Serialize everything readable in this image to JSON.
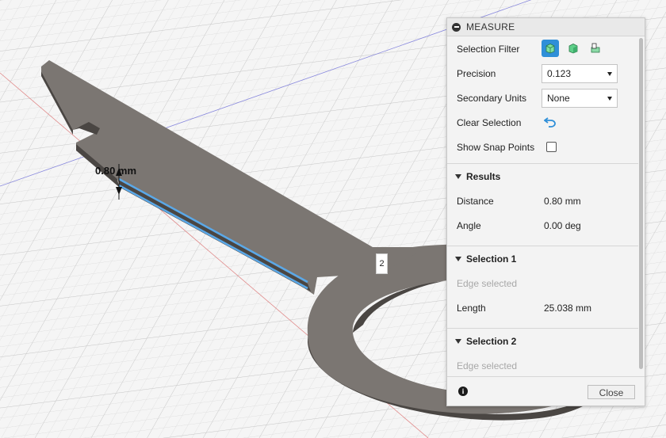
{
  "viewport": {
    "dimension_label": "0.80 mm",
    "vertex_label": "2"
  },
  "panel": {
    "title": "MEASURE",
    "selection_filter": {
      "label": "Selection Filter",
      "options": [
        "body-filter-icon",
        "face-filter-icon",
        "component-filter-icon"
      ],
      "active_index": 0
    },
    "precision": {
      "label": "Precision",
      "value": "0.123"
    },
    "secondary_units": {
      "label": "Secondary Units",
      "value": "None"
    },
    "clear_selection": {
      "label": "Clear Selection"
    },
    "show_snap_points": {
      "label": "Show Snap Points",
      "checked": false
    },
    "results": {
      "title": "Results",
      "distance": {
        "label": "Distance",
        "value": "0.80 mm"
      },
      "angle": {
        "label": "Angle",
        "value": "0.00 deg"
      }
    },
    "selection1": {
      "title": "Selection 1",
      "status": "Edge selected",
      "length": {
        "label": "Length",
        "value": "25.038 mm"
      }
    },
    "selection2": {
      "title": "Selection 2",
      "status": "Edge selected"
    },
    "close_label": "Close"
  },
  "colors": {
    "part_top": "#7b7672",
    "part_side": "#4a4643",
    "highlight": "#5aa8e8",
    "accent": "#2f8fd8"
  }
}
